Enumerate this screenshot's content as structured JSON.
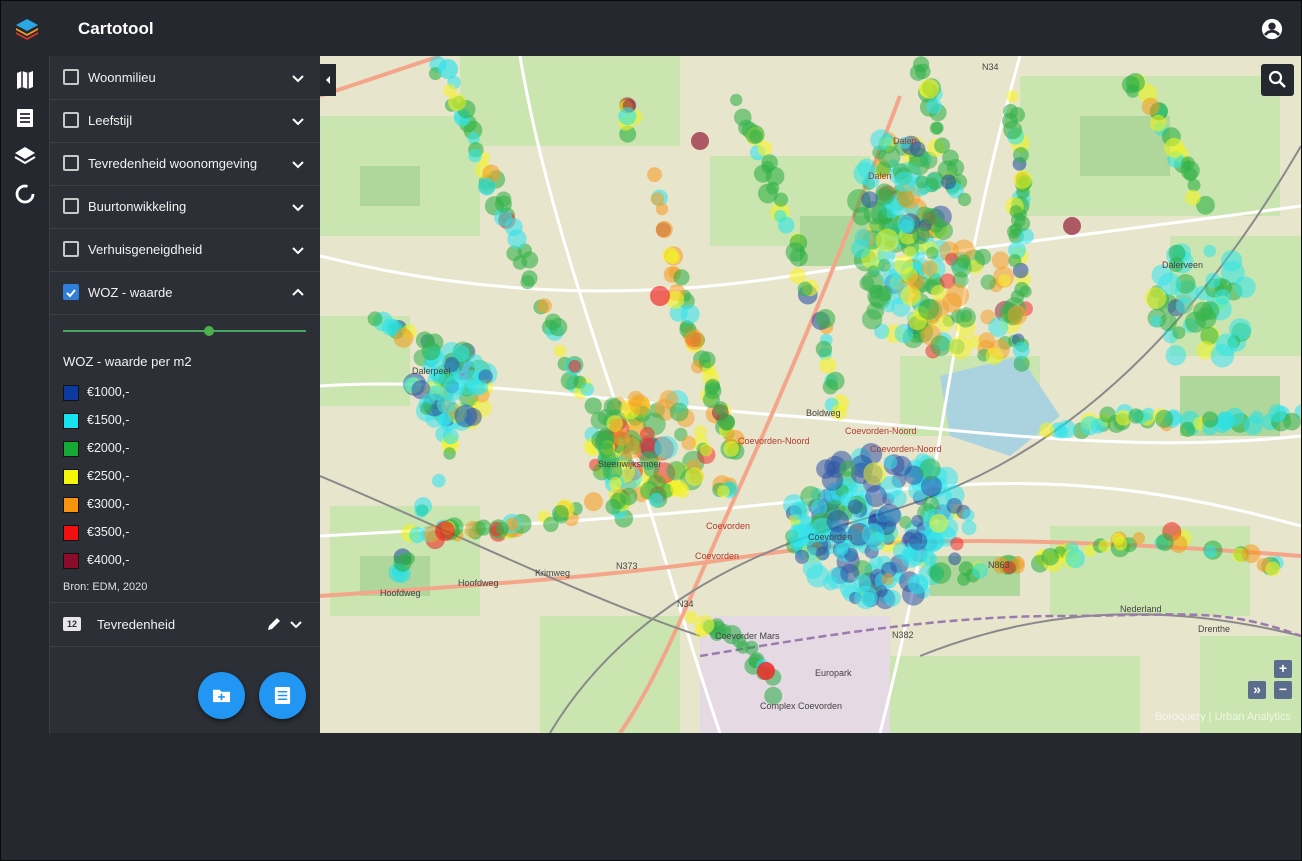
{
  "app": {
    "title": "Cartotool"
  },
  "layers": [
    {
      "label": "Woonmilieu",
      "checked": false,
      "expanded": false
    },
    {
      "label": "Leefstijl",
      "checked": false,
      "expanded": false
    },
    {
      "label": "Tevredenheid woonomgeving",
      "checked": false,
      "expanded": false
    },
    {
      "label": "Buurtonwikkeling",
      "checked": false,
      "expanded": false
    },
    {
      "label": "Verhuisgeneigdheid",
      "checked": false,
      "expanded": false
    },
    {
      "label": "WOZ - waarde",
      "checked": true,
      "expanded": true
    }
  ],
  "woz": {
    "opacity_fraction": 0.6,
    "legend_title": "WOZ - waarde per m2",
    "legend": [
      {
        "label": "€1000,-",
        "color": "#0d3a9e"
      },
      {
        "label": "€1500,-",
        "color": "#15e3f0"
      },
      {
        "label": "€2000,-",
        "color": "#16a834"
      },
      {
        "label": "€2500,-",
        "color": "#f5f50a"
      },
      {
        "label": "€3000,-",
        "color": "#f7930d"
      },
      {
        "label": "€3500,-",
        "color": "#f20f0f"
      },
      {
        "label": "€4000,-",
        "color": "#8c0a2a"
      }
    ],
    "source": "Bron: EDM, 2020"
  },
  "group": {
    "icon_text": "12",
    "label": "Tevredenheid"
  },
  "map": {
    "labels": [
      "Dalerpeel",
      "Dalerveen",
      "Coevorden-Noord",
      "Coevorden-Noord",
      "Coevorden-Noord",
      "Coevorden",
      "Coevorden",
      "Coevorden",
      "Steenwijksmoer",
      "Europark",
      "Coevorder Mars",
      "Complex Coevorden",
      "Nederland",
      "Drenthe",
      "Hoofdweg",
      "Hoofdweg",
      "Krimweg",
      "N34",
      "N34",
      "N373",
      "N382",
      "N863",
      "Dalen",
      "Dalen",
      "Boldweg"
    ],
    "attribution": "Boroquery | Urban Analytics",
    "zoom_in": "+",
    "zoom_out": "−",
    "expand": "»"
  },
  "icons": {
    "logo": "layers-logo-icon",
    "account": "account-circle-icon",
    "rail": [
      "map-icon",
      "list-icon",
      "layers-icon",
      "donut-chart-icon"
    ],
    "fab": [
      "add-folder-icon",
      "document-list-icon"
    ],
    "search": "search-icon"
  }
}
